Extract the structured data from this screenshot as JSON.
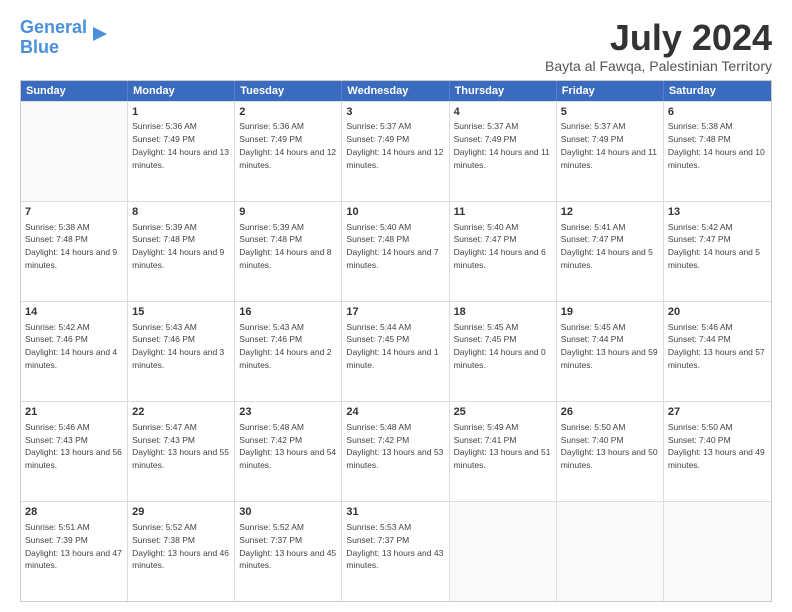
{
  "logo": {
    "line1": "General",
    "line2": "Blue"
  },
  "title": "July 2024",
  "subtitle": "Bayta al Fawqa, Palestinian Territory",
  "header_days": [
    "Sunday",
    "Monday",
    "Tuesday",
    "Wednesday",
    "Thursday",
    "Friday",
    "Saturday"
  ],
  "rows": [
    [
      {
        "day": "",
        "sunrise": "",
        "sunset": "",
        "daylight": ""
      },
      {
        "day": "1",
        "sunrise": "Sunrise: 5:36 AM",
        "sunset": "Sunset: 7:49 PM",
        "daylight": "Daylight: 14 hours and 13 minutes."
      },
      {
        "day": "2",
        "sunrise": "Sunrise: 5:36 AM",
        "sunset": "Sunset: 7:49 PM",
        "daylight": "Daylight: 14 hours and 12 minutes."
      },
      {
        "day": "3",
        "sunrise": "Sunrise: 5:37 AM",
        "sunset": "Sunset: 7:49 PM",
        "daylight": "Daylight: 14 hours and 12 minutes."
      },
      {
        "day": "4",
        "sunrise": "Sunrise: 5:37 AM",
        "sunset": "Sunset: 7:49 PM",
        "daylight": "Daylight: 14 hours and 11 minutes."
      },
      {
        "day": "5",
        "sunrise": "Sunrise: 5:37 AM",
        "sunset": "Sunset: 7:49 PM",
        "daylight": "Daylight: 14 hours and 11 minutes."
      },
      {
        "day": "6",
        "sunrise": "Sunrise: 5:38 AM",
        "sunset": "Sunset: 7:48 PM",
        "daylight": "Daylight: 14 hours and 10 minutes."
      }
    ],
    [
      {
        "day": "7",
        "sunrise": "Sunrise: 5:38 AM",
        "sunset": "Sunset: 7:48 PM",
        "daylight": "Daylight: 14 hours and 9 minutes."
      },
      {
        "day": "8",
        "sunrise": "Sunrise: 5:39 AM",
        "sunset": "Sunset: 7:48 PM",
        "daylight": "Daylight: 14 hours and 9 minutes."
      },
      {
        "day": "9",
        "sunrise": "Sunrise: 5:39 AM",
        "sunset": "Sunset: 7:48 PM",
        "daylight": "Daylight: 14 hours and 8 minutes."
      },
      {
        "day": "10",
        "sunrise": "Sunrise: 5:40 AM",
        "sunset": "Sunset: 7:48 PM",
        "daylight": "Daylight: 14 hours and 7 minutes."
      },
      {
        "day": "11",
        "sunrise": "Sunrise: 5:40 AM",
        "sunset": "Sunset: 7:47 PM",
        "daylight": "Daylight: 14 hours and 6 minutes."
      },
      {
        "day": "12",
        "sunrise": "Sunrise: 5:41 AM",
        "sunset": "Sunset: 7:47 PM",
        "daylight": "Daylight: 14 hours and 5 minutes."
      },
      {
        "day": "13",
        "sunrise": "Sunrise: 5:42 AM",
        "sunset": "Sunset: 7:47 PM",
        "daylight": "Daylight: 14 hours and 5 minutes."
      }
    ],
    [
      {
        "day": "14",
        "sunrise": "Sunrise: 5:42 AM",
        "sunset": "Sunset: 7:46 PM",
        "daylight": "Daylight: 14 hours and 4 minutes."
      },
      {
        "day": "15",
        "sunrise": "Sunrise: 5:43 AM",
        "sunset": "Sunset: 7:46 PM",
        "daylight": "Daylight: 14 hours and 3 minutes."
      },
      {
        "day": "16",
        "sunrise": "Sunrise: 5:43 AM",
        "sunset": "Sunset: 7:46 PM",
        "daylight": "Daylight: 14 hours and 2 minutes."
      },
      {
        "day": "17",
        "sunrise": "Sunrise: 5:44 AM",
        "sunset": "Sunset: 7:45 PM",
        "daylight": "Daylight: 14 hours and 1 minute."
      },
      {
        "day": "18",
        "sunrise": "Sunrise: 5:45 AM",
        "sunset": "Sunset: 7:45 PM",
        "daylight": "Daylight: 14 hours and 0 minutes."
      },
      {
        "day": "19",
        "sunrise": "Sunrise: 5:45 AM",
        "sunset": "Sunset: 7:44 PM",
        "daylight": "Daylight: 13 hours and 59 minutes."
      },
      {
        "day": "20",
        "sunrise": "Sunrise: 5:46 AM",
        "sunset": "Sunset: 7:44 PM",
        "daylight": "Daylight: 13 hours and 57 minutes."
      }
    ],
    [
      {
        "day": "21",
        "sunrise": "Sunrise: 5:46 AM",
        "sunset": "Sunset: 7:43 PM",
        "daylight": "Daylight: 13 hours and 56 minutes."
      },
      {
        "day": "22",
        "sunrise": "Sunrise: 5:47 AM",
        "sunset": "Sunset: 7:43 PM",
        "daylight": "Daylight: 13 hours and 55 minutes."
      },
      {
        "day": "23",
        "sunrise": "Sunrise: 5:48 AM",
        "sunset": "Sunset: 7:42 PM",
        "daylight": "Daylight: 13 hours and 54 minutes."
      },
      {
        "day": "24",
        "sunrise": "Sunrise: 5:48 AM",
        "sunset": "Sunset: 7:42 PM",
        "daylight": "Daylight: 13 hours and 53 minutes."
      },
      {
        "day": "25",
        "sunrise": "Sunrise: 5:49 AM",
        "sunset": "Sunset: 7:41 PM",
        "daylight": "Daylight: 13 hours and 51 minutes."
      },
      {
        "day": "26",
        "sunrise": "Sunrise: 5:50 AM",
        "sunset": "Sunset: 7:40 PM",
        "daylight": "Daylight: 13 hours and 50 minutes."
      },
      {
        "day": "27",
        "sunrise": "Sunrise: 5:50 AM",
        "sunset": "Sunset: 7:40 PM",
        "daylight": "Daylight: 13 hours and 49 minutes."
      }
    ],
    [
      {
        "day": "28",
        "sunrise": "Sunrise: 5:51 AM",
        "sunset": "Sunset: 7:39 PM",
        "daylight": "Daylight: 13 hours and 47 minutes."
      },
      {
        "day": "29",
        "sunrise": "Sunrise: 5:52 AM",
        "sunset": "Sunset: 7:38 PM",
        "daylight": "Daylight: 13 hours and 46 minutes."
      },
      {
        "day": "30",
        "sunrise": "Sunrise: 5:52 AM",
        "sunset": "Sunset: 7:37 PM",
        "daylight": "Daylight: 13 hours and 45 minutes."
      },
      {
        "day": "31",
        "sunrise": "Sunrise: 5:53 AM",
        "sunset": "Sunset: 7:37 PM",
        "daylight": "Daylight: 13 hours and 43 minutes."
      },
      {
        "day": "",
        "sunrise": "",
        "sunset": "",
        "daylight": ""
      },
      {
        "day": "",
        "sunrise": "",
        "sunset": "",
        "daylight": ""
      },
      {
        "day": "",
        "sunrise": "",
        "sunset": "",
        "daylight": ""
      }
    ]
  ]
}
